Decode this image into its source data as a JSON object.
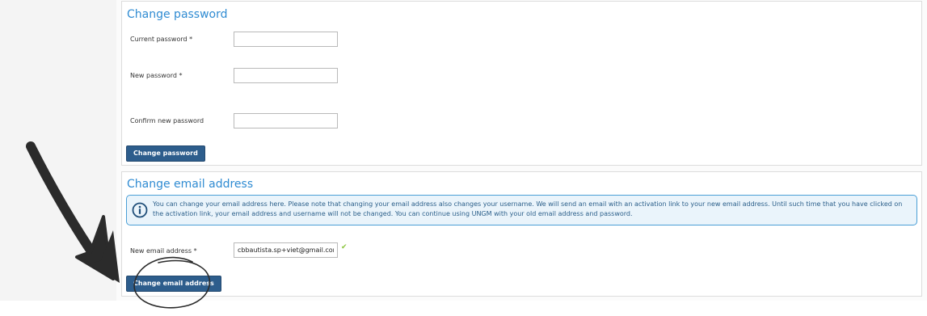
{
  "change_password": {
    "title": "Change password",
    "fields": [
      {
        "label": "Current password *",
        "value": ""
      },
      {
        "label": "New password *",
        "value": ""
      },
      {
        "label": "Confirm new password",
        "value": ""
      }
    ],
    "button_label": "Change password"
  },
  "change_email": {
    "title": "Change email address",
    "info_icon": "info-circle-icon",
    "info_text": "You can change your email address here. Please note that changing your email address also changes your username. We will send an email with an activation link to your new email address. Until such time that you have clicked on the activation link, your email address and username will not be changed. You can continue using UNGM with your old email address and password.",
    "field": {
      "label": "New email address *",
      "value": "cbbautista.sp+viet@gmail.com"
    },
    "valid_icon": "checkmark-icon",
    "button_label": "Change email address"
  },
  "annotation": {
    "arrow_icon": "hand-drawn-arrow-icon",
    "circle_icon": "hand-drawn-circle-icon",
    "color": "#2b2b2b"
  },
  "colors": {
    "title": "#2f8bd2",
    "button": "#2d5d8c",
    "info_border": "#4a9fd6",
    "info_bg": "#eaf4fb",
    "check": "#8cc63f"
  }
}
